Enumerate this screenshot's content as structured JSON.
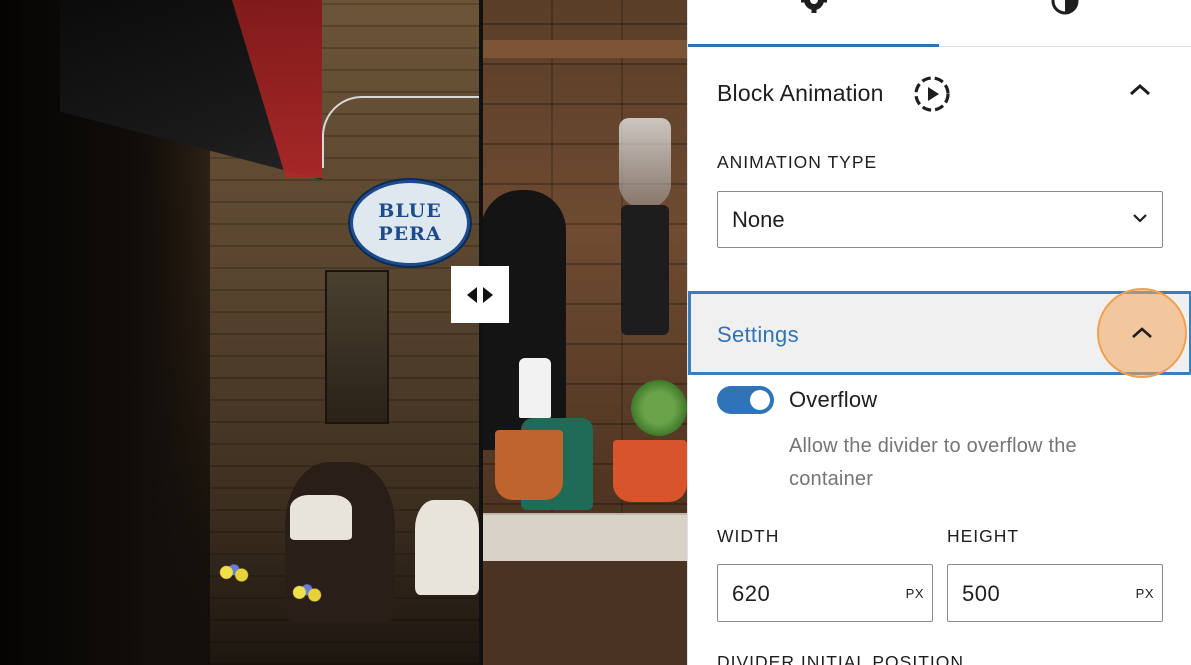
{
  "preview": {
    "sign_line1": "BLUE",
    "sign_line2": "PERA"
  },
  "tabs": [
    {
      "name": "settings",
      "icon": "gear-icon",
      "active": true
    },
    {
      "name": "styles",
      "icon": "contrast-icon",
      "active": false
    }
  ],
  "block_animation": {
    "title": "Block Animation",
    "animation_type_label": "ANIMATION TYPE",
    "animation_type_value": "None",
    "expanded": true
  },
  "settings": {
    "title": "Settings",
    "expanded": true,
    "overflow_label": "Overflow",
    "overflow_on": true,
    "overflow_help": "Allow the divider to overflow the container",
    "width_label": "WIDTH",
    "width_value": "620",
    "width_unit": "PX",
    "height_label": "HEIGHT",
    "height_value": "500",
    "height_unit": "PX",
    "divider_position_label": "DIVIDER INITIAL POSITION"
  },
  "colors": {
    "accent": "#2f73b8",
    "highlight": "#f0a050"
  }
}
